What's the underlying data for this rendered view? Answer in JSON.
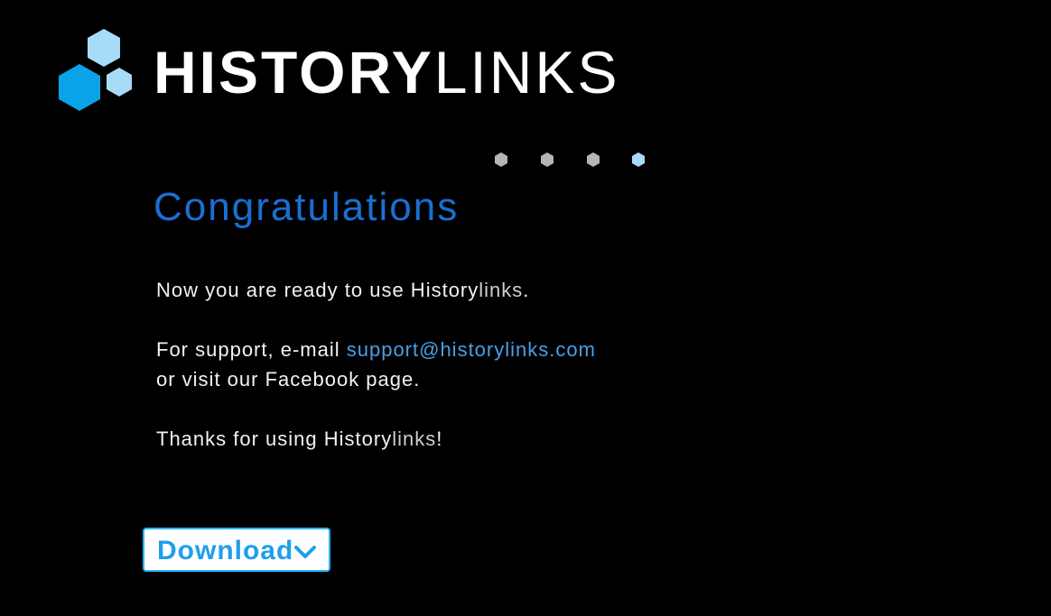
{
  "logo": {
    "bold": "HISTORY",
    "light": "LINKS"
  },
  "steps": {
    "count": 4,
    "current": 4,
    "colors": {
      "inactive": "#b5b5b5",
      "active": "#a6dcf7"
    }
  },
  "heading": "Congratulations",
  "message": {
    "line1_prefix": "Now you are ready to use History",
    "line1_suffix": "links",
    "line1_end": ".",
    "support_prefix": "For support, e-mail ",
    "support_email": "support@historylinks.com",
    "facebook_line": "or visit our Facebook page.",
    "thanks_prefix": "Thanks for using  History",
    "thanks_suffix": "links",
    "thanks_end": "!"
  },
  "download_button": {
    "label": "Download",
    "icon": "chevron-down-icon"
  },
  "colors": {
    "background": "#000000",
    "heading": "#1a6fd0",
    "link": "#4a9fe6",
    "button_text": "#1f9fea",
    "button_border": "#2bb3ff",
    "logo_hex_light": "#a6dcf7",
    "logo_hex_dark": "#0aa3e8"
  }
}
